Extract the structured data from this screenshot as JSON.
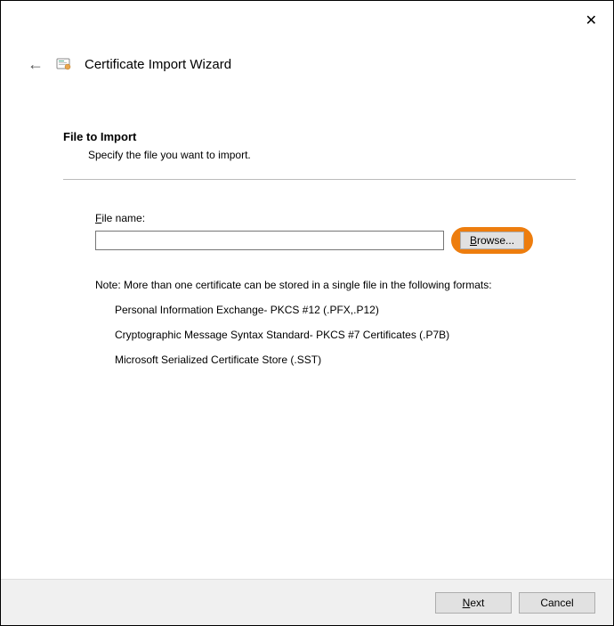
{
  "header": {
    "title": "Certificate Import Wizard"
  },
  "content": {
    "heading": "File to Import",
    "subheading": "Specify the file you want to import.",
    "file_label_pre": "F",
    "file_label_post": "ile name:",
    "file_value": "",
    "browse_pre": "B",
    "browse_post": "rowse...",
    "note_intro": "Note:  More than one certificate can be stored in a single file in the following formats:",
    "formats": [
      "Personal Information Exchange- PKCS #12 (.PFX,.P12)",
      "Cryptographic Message Syntax Standard- PKCS #7 Certificates (.P7B)",
      "Microsoft Serialized Certificate Store (.SST)"
    ]
  },
  "footer": {
    "next_pre": "N",
    "next_post": "ext",
    "cancel": "Cancel"
  }
}
